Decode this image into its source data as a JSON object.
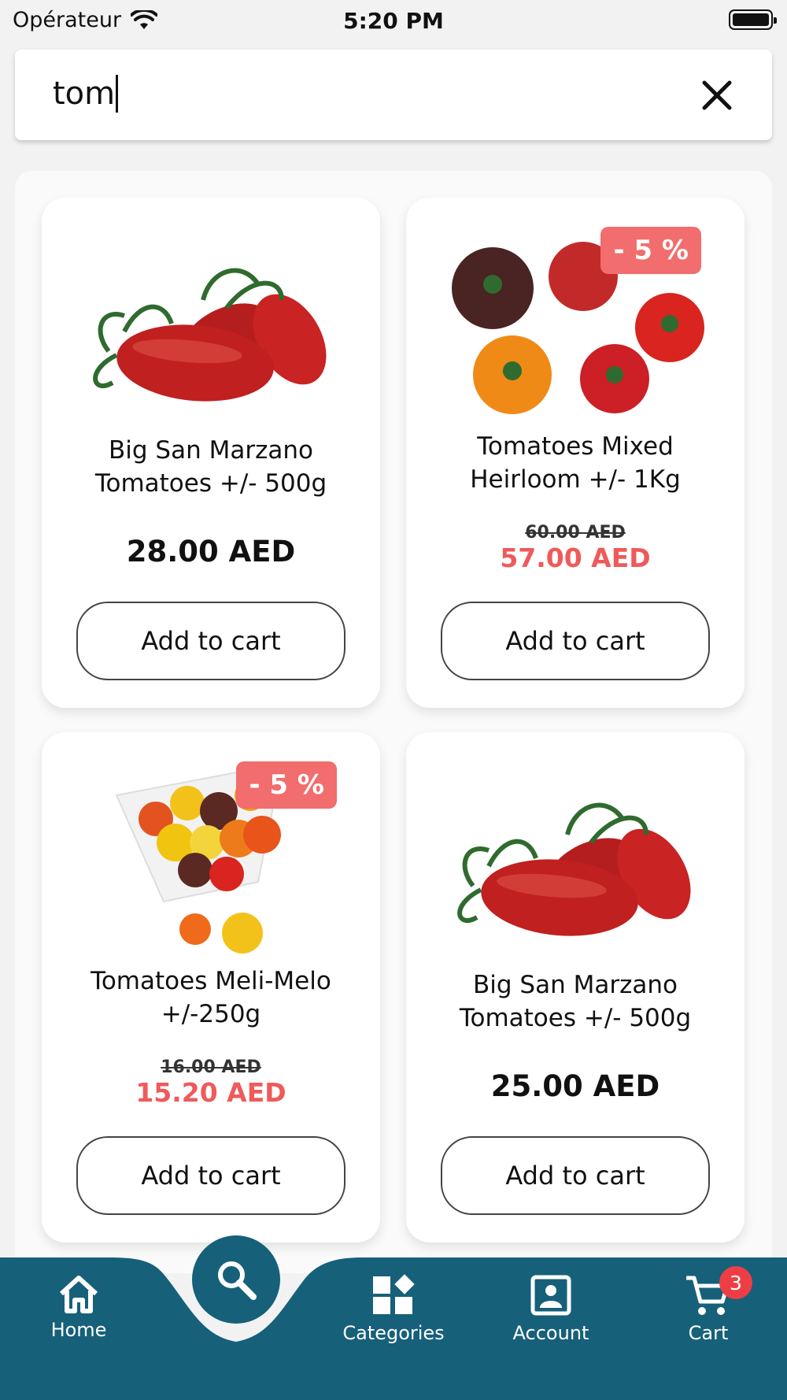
{
  "status_bar": {
    "carrier": "Opérateur",
    "time": "5:20 PM"
  },
  "search": {
    "value": "tom"
  },
  "products": [
    {
      "name_line1": "Big San Marzano",
      "name_line2": "Tomatoes +/- 500g",
      "price": "28.00 AED",
      "button": "Add to cart"
    },
    {
      "name_line1": "Tomatoes Mixed",
      "name_line2": "Heirloom +/- 1Kg",
      "badge": "- 5 %",
      "old_price": "60.00 AED",
      "new_price": "57.00 AED",
      "button": "Add to cart"
    },
    {
      "name_line1": "Tomatoes Meli-Melo",
      "name_line2": "+/-250g",
      "badge": "- 5 %",
      "old_price": "16.00 AED",
      "new_price": "15.20 AED",
      "button": "Add to cart"
    },
    {
      "name_line1": "Big San Marzano",
      "name_line2": "Tomatoes +/- 500g",
      "price": "25.00 AED",
      "button": "Add to cart"
    }
  ],
  "tab_bar": {
    "items": [
      {
        "label": "Home",
        "icon": "home-icon"
      },
      {
        "label": "Search",
        "icon": "search-icon"
      },
      {
        "label": "Categories",
        "icon": "categories-icon"
      },
      {
        "label": "Account",
        "icon": "account-icon"
      },
      {
        "label": "Cart",
        "icon": "cart-icon"
      }
    ],
    "cart_count": "3"
  },
  "colors": {
    "tab_bar": "#16607a",
    "discount": "#f26d6d",
    "sale_price": "#ef5a5a",
    "cart_badge": "#ee3e45"
  }
}
